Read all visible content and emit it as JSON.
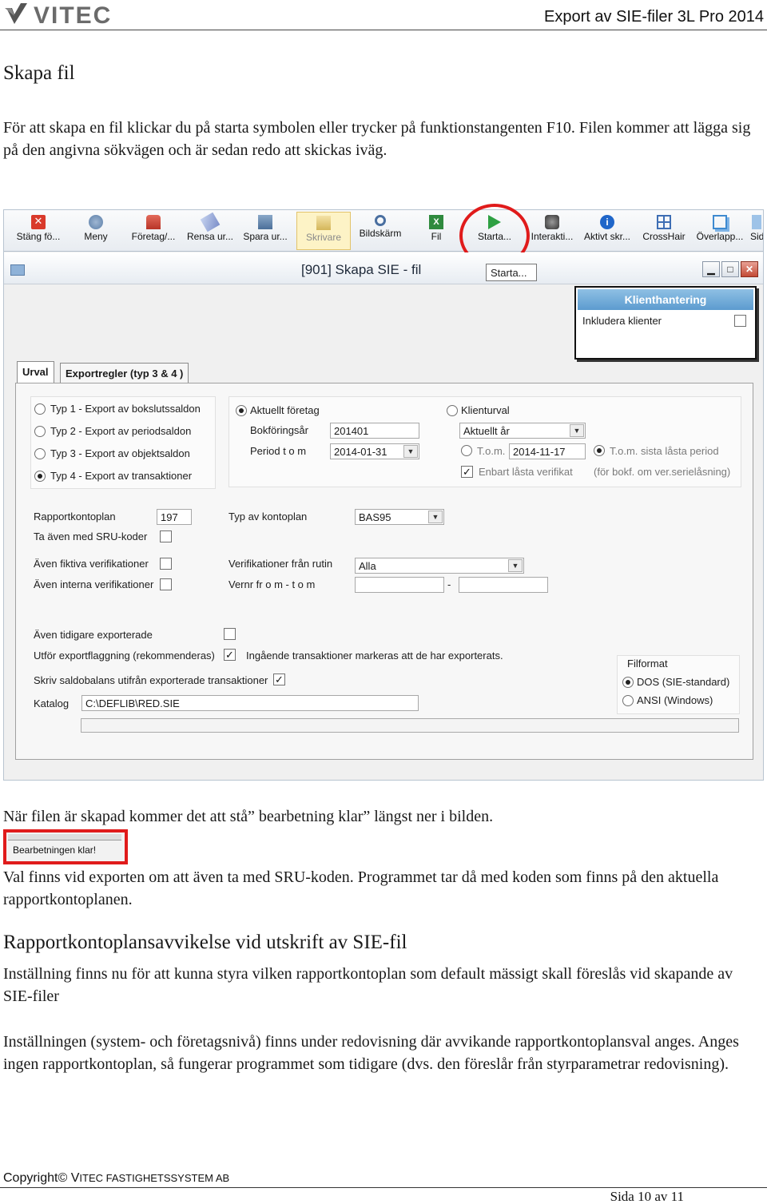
{
  "header": {
    "logo_text": "VITEC",
    "doc_title": "Export av SIE-filer 3L Pro 2014"
  },
  "section1": {
    "heading": "Skapa fil",
    "para1": "För att skapa en fil klickar du på starta symbolen eller trycker på funktionstangenten F10. Filen kommer att lägga sig på den angivna sökvägen och är sedan redo att skickas iväg."
  },
  "app": {
    "toolbar": [
      {
        "label": "Stäng fö...",
        "icon": "close-icon"
      },
      {
        "label": "Meny",
        "icon": "menu-icon"
      },
      {
        "label": "Företag/...",
        "icon": "company-icon"
      },
      {
        "label": "Rensa ur...",
        "icon": "eraser-icon"
      },
      {
        "label": "Spara ur...",
        "icon": "save-icon"
      },
      {
        "label": "Skrivare",
        "icon": "printer-icon"
      },
      {
        "label": "Bildskärm",
        "icon": "magnifier-icon"
      },
      {
        "label": "Fil",
        "icon": "excel-icon"
      },
      {
        "label": "Starta...",
        "icon": "play-icon"
      },
      {
        "label": "Interakti...",
        "icon": "interactive-icon"
      },
      {
        "label": "Aktivt skr...",
        "icon": "info-icon"
      },
      {
        "label": "CrossHair",
        "icon": "crosshair-icon"
      },
      {
        "label": "Överlapp...",
        "icon": "overlap-icon"
      },
      {
        "label": "Sid",
        "icon": "page-icon"
      }
    ],
    "window_title": "[901]  Skapa SIE - fil",
    "tooltip": "Starta...",
    "win_buttons": [
      "▁",
      "□",
      "✕"
    ],
    "client_panel": {
      "title": "Klienthantering",
      "include_label": "Inkludera klienter"
    },
    "tabs": [
      "Urval",
      "Exportregler (typ 3 & 4 )"
    ],
    "types": [
      "Typ 1 - Export av bokslutssaldon",
      "Typ 2 - Export av periodsaldon",
      "Typ 3 - Export av objektsaldon",
      "Typ 4 - Export av transaktioner"
    ],
    "current_company": {
      "label": "Aktuellt företag",
      "year_label": "Bokföringsår",
      "year_value": "201401",
      "period_label": "Period t o m",
      "period_value": "2014-01-31"
    },
    "client_selection": {
      "label": "Klienturval",
      "year_combo": "Aktuellt år",
      "tom_label": "T.o.m.",
      "tom_value": "2014-11-17",
      "locked_label": "T.o.m. sista låsta period",
      "only_locked": "Enbart låsta verifikat",
      "note": "(för bokf. om ver.serielåsning)"
    },
    "report_plan": {
      "label": "Rapportkontoplan",
      "value": "197"
    },
    "sru_label": "Ta även med SRU-koder",
    "plan_type": {
      "label": "Typ av kontoplan",
      "value": "BAS95"
    },
    "fictive_label": "Även fiktiva verifikationer",
    "internal_label": "Även interna verifikationer",
    "routine": {
      "label": "Verifikationer från rutin",
      "value": "Alla"
    },
    "vernr": {
      "label": "Vernr fr o m - t o m",
      "dash": "-"
    },
    "prev_exported_label": "Även tidigare exporterade",
    "flagging_label": "Utför exportflaggning (rekommenderas)",
    "flagging_note": "Ingående transaktioner markeras att de har exporterats.",
    "balance_label": "Skriv saldobalans utifrån exporterade transaktioner",
    "catalog": {
      "label": "Katalog",
      "value": "C:\\DEFLIB\\RED.SIE"
    },
    "file_format": {
      "title": "Filformat",
      "options": [
        "DOS (SIE-standard)",
        "ANSI (Windows)"
      ]
    }
  },
  "section2": {
    "para_done": "När filen är skapad kommer det att stå” bearbetning klar” längst ner i bilden.",
    "status_text": "Bearbetningen klar!",
    "para_sru": "Val finns vid exporten om att även ta med SRU-koden. Programmet tar då med koden som finns på den aktuella rapportkontoplanen."
  },
  "section3": {
    "heading": "Rapportkontoplansavvikelse vid utskrift av SIE-fil",
    "para1": "Inställning finns nu för att kunna styra vilken rapportkontoplan som default mässigt skall föreslås vid skapande av SIE-filer",
    "para2": "Inställningen (system- och företagsnivå) finns under redovisning där avvikande rapportkontoplansval anges. Anges ingen rapportkontoplan, så fungerar programmet som tidigare (dvs. den föreslår från styrparametrar redovisning)."
  },
  "footer": {
    "copyright_prefix": "Copyright© V",
    "copyright_rest": "ITEC FASTIGHETSSYSTEM AB",
    "page": "Sida 10 av 11"
  },
  "colors": {
    "highlight": "#e01b1b",
    "client_head": "#5c9bcf"
  }
}
